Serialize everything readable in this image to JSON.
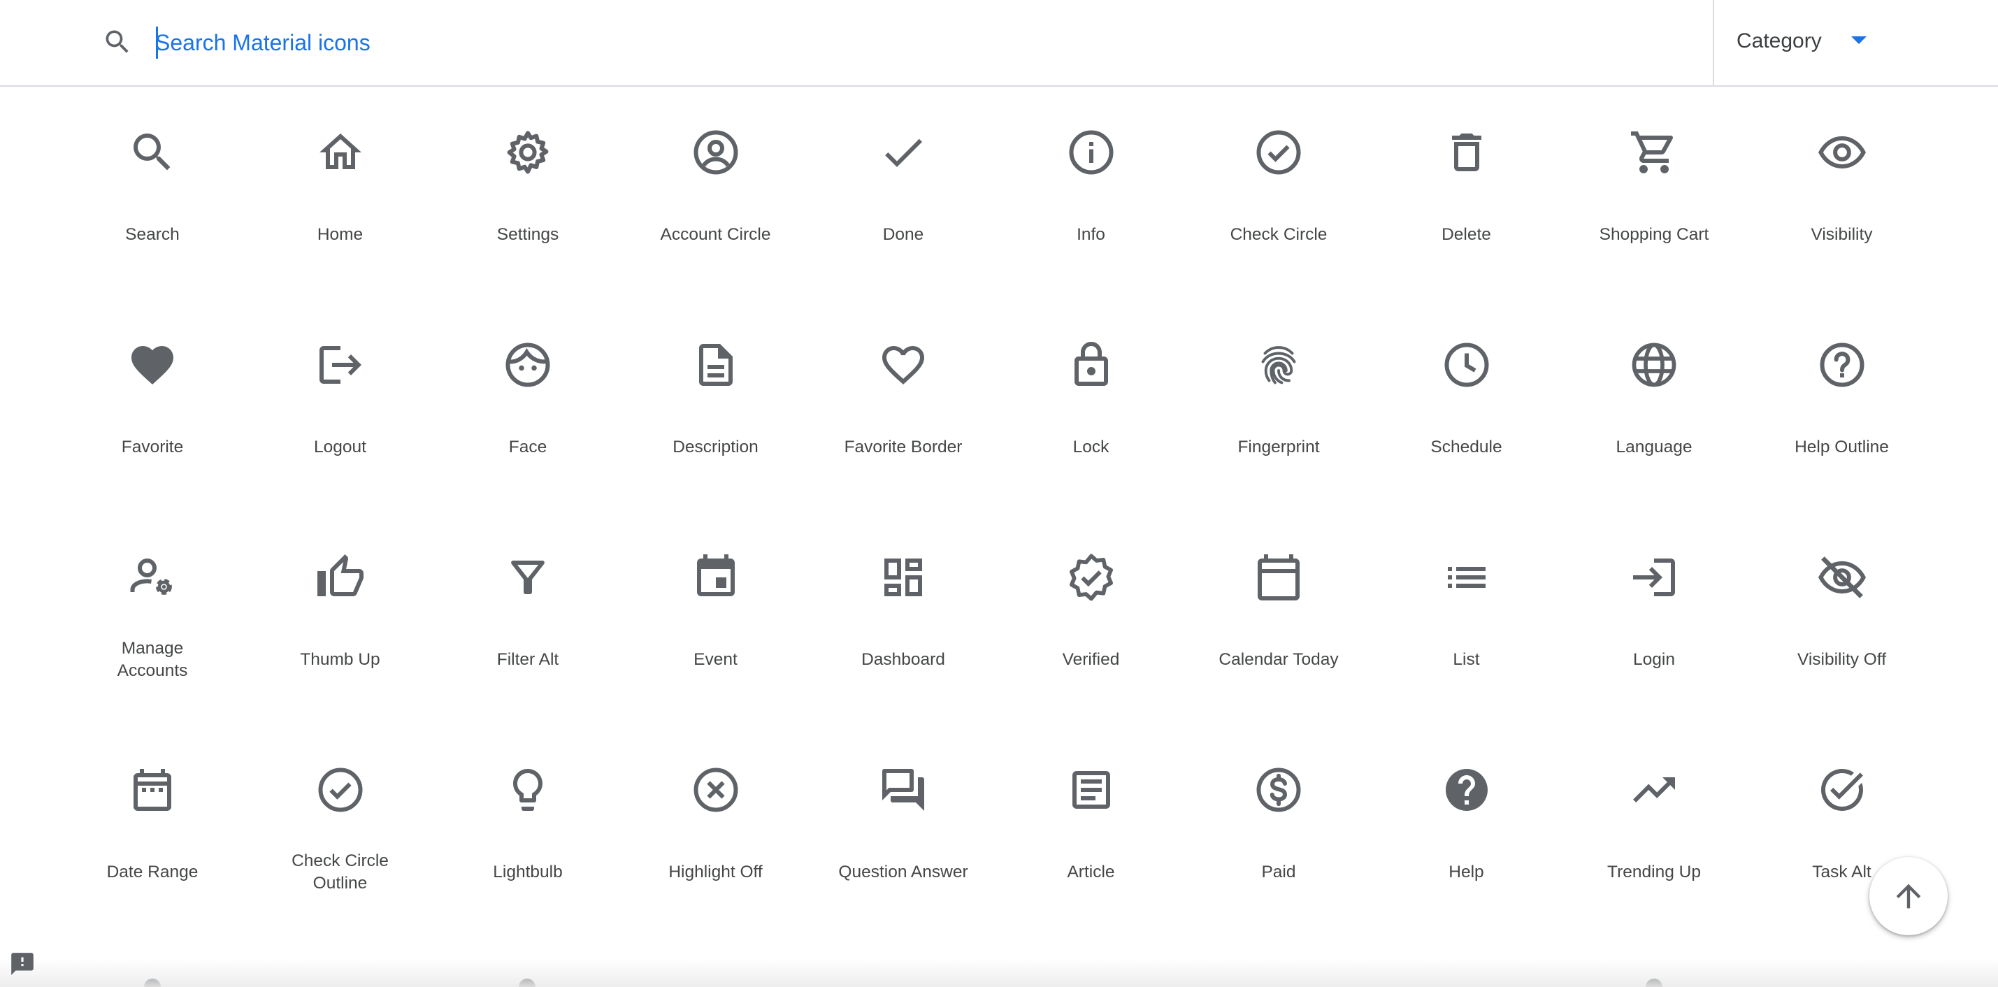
{
  "search": {
    "placeholder": "Search Material icons"
  },
  "category": {
    "label": "Category"
  },
  "colors": {
    "accent": "#1a73e8",
    "icon": "#5f6368",
    "text": "#444746"
  },
  "icons": [
    {
      "label": "Search",
      "icon": "search-icon"
    },
    {
      "label": "Home",
      "icon": "home-icon"
    },
    {
      "label": "Settings",
      "icon": "settings-icon"
    },
    {
      "label": "Account Circle",
      "icon": "account-circle-icon"
    },
    {
      "label": "Done",
      "icon": "done-icon"
    },
    {
      "label": "Info",
      "icon": "info-icon"
    },
    {
      "label": "Check Circle",
      "icon": "check-circle-icon"
    },
    {
      "label": "Delete",
      "icon": "delete-icon"
    },
    {
      "label": "Shopping Cart",
      "icon": "shopping-cart-icon"
    },
    {
      "label": "Visibility",
      "icon": "visibility-icon"
    },
    {
      "label": "Favorite",
      "icon": "favorite-icon"
    },
    {
      "label": "Logout",
      "icon": "logout-icon"
    },
    {
      "label": "Face",
      "icon": "face-icon"
    },
    {
      "label": "Description",
      "icon": "description-icon"
    },
    {
      "label": "Favorite Border",
      "icon": "favorite-border-icon"
    },
    {
      "label": "Lock",
      "icon": "lock-icon"
    },
    {
      "label": "Fingerprint",
      "icon": "fingerprint-icon"
    },
    {
      "label": "Schedule",
      "icon": "schedule-icon"
    },
    {
      "label": "Language",
      "icon": "language-icon"
    },
    {
      "label": "Help Outline",
      "icon": "help-outline-icon"
    },
    {
      "label": "Manage Accounts",
      "icon": "manage-accounts-icon"
    },
    {
      "label": "Thumb Up",
      "icon": "thumb-up-icon"
    },
    {
      "label": "Filter Alt",
      "icon": "filter-alt-icon"
    },
    {
      "label": "Event",
      "icon": "event-icon"
    },
    {
      "label": "Dashboard",
      "icon": "dashboard-icon"
    },
    {
      "label": "Verified",
      "icon": "verified-icon"
    },
    {
      "label": "Calendar Today",
      "icon": "calendar-today-icon"
    },
    {
      "label": "List",
      "icon": "list-icon"
    },
    {
      "label": "Login",
      "icon": "login-icon"
    },
    {
      "label": "Visibility Off",
      "icon": "visibility-off-icon"
    },
    {
      "label": "Date Range",
      "icon": "date-range-icon"
    },
    {
      "label": "Check Circle Outline",
      "icon": "check-circle-outline-icon"
    },
    {
      "label": "Lightbulb",
      "icon": "lightbulb-icon"
    },
    {
      "label": "Highlight Off",
      "icon": "highlight-off-icon"
    },
    {
      "label": "Question Answer",
      "icon": "question-answer-icon"
    },
    {
      "label": "Article",
      "icon": "article-icon"
    },
    {
      "label": "Paid",
      "icon": "paid-icon"
    },
    {
      "label": "Help",
      "icon": "help-icon"
    },
    {
      "label": "Trending Up",
      "icon": "trending-up-icon"
    },
    {
      "label": "Task Alt",
      "icon": "task-alt-icon"
    }
  ],
  "scroll_top": {
    "icon": "arrow-upward-icon"
  },
  "feedback": {
    "icon": "feedback-icon"
  }
}
